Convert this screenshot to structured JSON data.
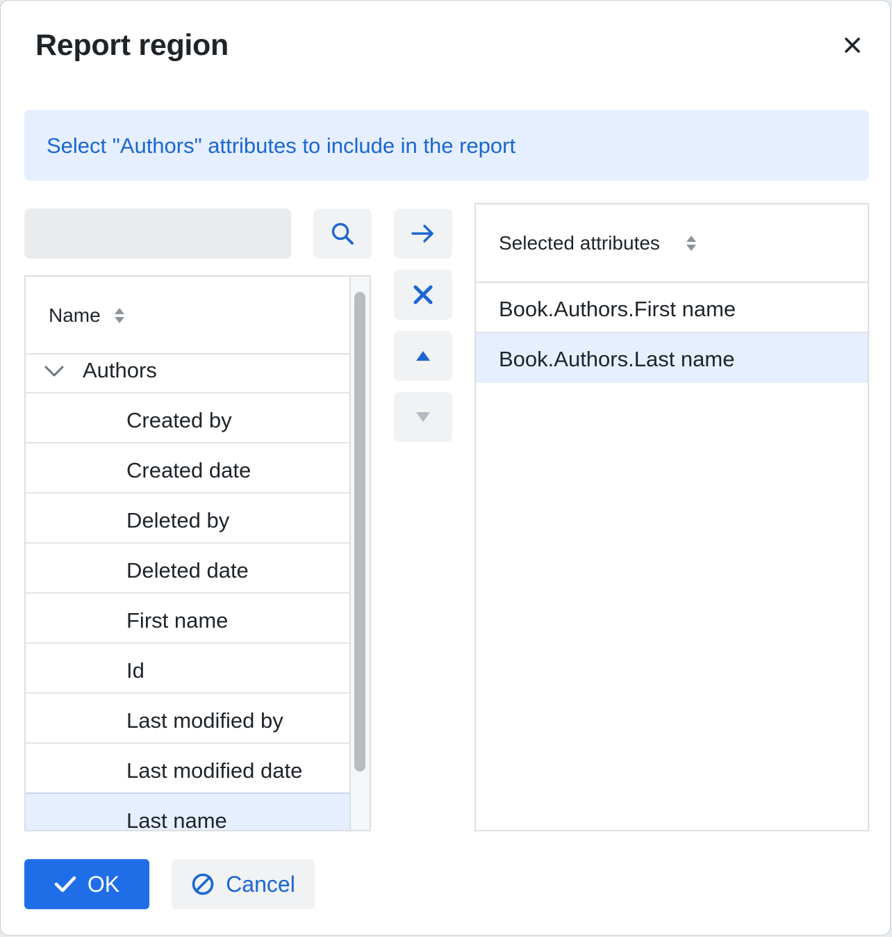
{
  "dialog": {
    "title": "Report region",
    "close_icon": "close-icon"
  },
  "banner": {
    "text": "Select \"Authors\" attributes to include in the report"
  },
  "search": {
    "value": "",
    "placeholder": ""
  },
  "controls": {
    "search_icon": "search-icon",
    "add_icon": "arrow-right-icon",
    "remove_icon": "x-icon",
    "move_up_icon": "triangle-up-icon",
    "move_down_icon": "triangle-down-icon"
  },
  "left_table": {
    "header": "Name",
    "group": "Authors",
    "rows": [
      "Created by",
      "Created date",
      "Deleted by",
      "Deleted date",
      "First name",
      "Id",
      "Last modified by",
      "Last modified date",
      "Last name"
    ],
    "selected_row": "Last name"
  },
  "right_table": {
    "header": "Selected attributes",
    "rows": [
      "Book.Authors.First name",
      "Book.Authors.Last name"
    ],
    "selected_row": "Book.Authors.Last name"
  },
  "footer": {
    "ok_label": "OK",
    "cancel_label": "Cancel"
  },
  "colors": {
    "accent": "#1f6ee8",
    "link": "#1b66d2",
    "selected_row": "#e5efff",
    "disabled_icon": "#b3bac4"
  }
}
